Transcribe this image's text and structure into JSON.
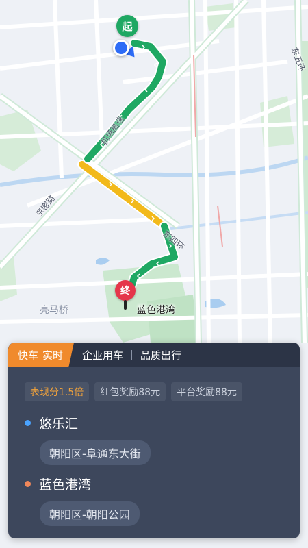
{
  "map": {
    "start_marker": "起",
    "end_marker": "终",
    "destination_label": "蓝色港湾",
    "place_labels": {
      "liangmaqiao": "亮马桥"
    },
    "road_labels": {
      "airport_expressway": "机场高速",
      "jingmi_road": "京密路",
      "east_fourth_ring": "东四环",
      "east_fifth_ring": "东五环"
    },
    "route_colors": {
      "clear": "#1fa863",
      "slow": "#f2b91a"
    }
  },
  "panel": {
    "tabs": {
      "active": "快车",
      "active_suffix": "实时",
      "enterprise": "企业用车",
      "quality": "品质出行"
    },
    "tags": [
      "表现分1.5倍",
      "红包奖励88元",
      "平台奖励88元"
    ],
    "stops": [
      {
        "name": "悠乐汇",
        "address": "朝阳区-阜通东大街",
        "dot_color": "#4aa3ff"
      },
      {
        "name": "蓝色港湾",
        "address": "朝阳区-朝阳公园",
        "dot_color": "#f0875a"
      }
    ]
  }
}
